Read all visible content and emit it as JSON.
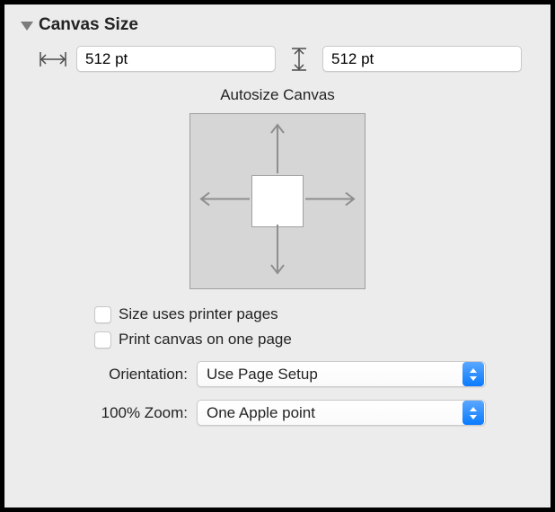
{
  "section": {
    "title": "Canvas Size"
  },
  "dimensions": {
    "width": "512 pt",
    "height": "512 pt"
  },
  "autosize": {
    "label": "Autosize Canvas"
  },
  "checkboxes": {
    "printer_pages": "Size uses printer pages",
    "one_page": "Print canvas on one page"
  },
  "orientation": {
    "label": "Orientation:",
    "value": "Use Page Setup"
  },
  "zoom": {
    "label": "100% Zoom:",
    "value": "One Apple point"
  }
}
